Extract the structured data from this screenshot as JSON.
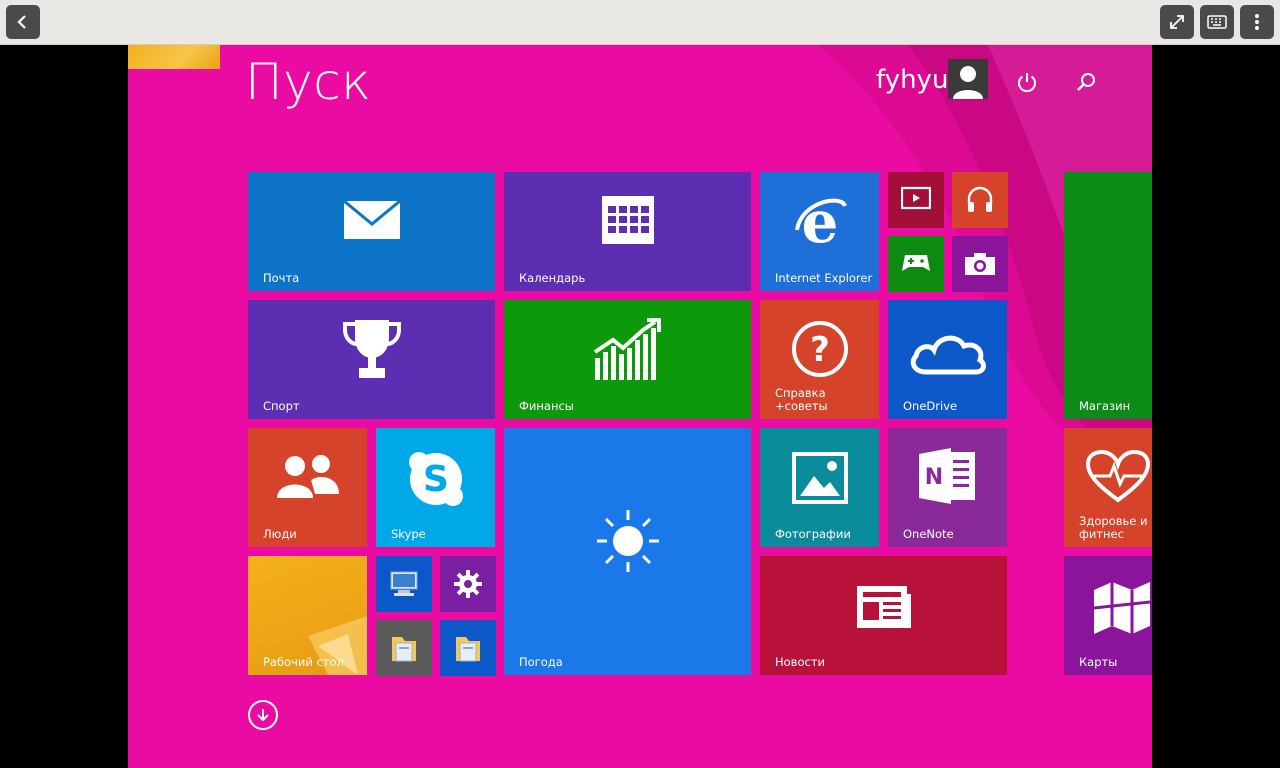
{
  "topbar": {
    "back_icon": "chevron-left-icon",
    "fullscreen_icon": "expand-icon",
    "keyboard_icon": "keyboard-icon",
    "menu_icon": "more-vertical-icon"
  },
  "start": {
    "title": "Пуск",
    "username": "fyhyu",
    "power_icon": "power-icon",
    "search_icon": "search-icon"
  },
  "tiles": {
    "mail": {
      "label": "Почта",
      "color": "#0d74c8",
      "icon": "mail-icon"
    },
    "calendar": {
      "label": "Календарь",
      "color": "#5b2eb2",
      "icon": "calendar-icon"
    },
    "ie": {
      "label": "Internet Explorer",
      "color": "#1f6fd8",
      "icon": "internet-explorer-icon"
    },
    "video": {
      "label": "",
      "color": "#a2103a",
      "icon": "video-icon"
    },
    "music": {
      "label": "",
      "color": "#d4432a",
      "icon": "headphones-icon"
    },
    "games": {
      "label": "",
      "color": "#0f8a10",
      "icon": "gamepad-icon"
    },
    "camera": {
      "label": "",
      "color": "#8b149a",
      "icon": "camera-icon"
    },
    "store": {
      "label": "Магазин",
      "color": "#0c8c17",
      "icon": "store-icon"
    },
    "sport": {
      "label": "Спорт",
      "color": "#5b2eb2",
      "icon": "trophy-icon"
    },
    "finance": {
      "label": "Финансы",
      "color": "#0c9a0a",
      "icon": "finance-chart-icon"
    },
    "help": {
      "label": "Справка\n+советы",
      "color": "#d4432a",
      "icon": "help-icon"
    },
    "onedrive": {
      "label": "OneDrive",
      "color": "#0d58c8",
      "icon": "cloud-icon"
    },
    "people": {
      "label": "Люди",
      "color": "#d4432a",
      "icon": "people-icon"
    },
    "skype": {
      "label": "Skype",
      "color": "#00a8e8",
      "icon": "skype-icon"
    },
    "weather": {
      "label": "Погода",
      "color": "#1b78e8",
      "icon": "sun-icon"
    },
    "photos": {
      "label": "Фотографии",
      "color": "#0a8c9a",
      "icon": "photos-icon"
    },
    "onenote": {
      "label": "OneNote",
      "color": "#8a2a9a",
      "icon": "onenote-icon"
    },
    "health": {
      "label": "Здоровье и\nфитнес",
      "color": "#d4432a",
      "icon": "heart-pulse-icon"
    },
    "desktop": {
      "label": "Рабочий стол",
      "color": "#e9a615",
      "icon": "desktop-wallpaper"
    },
    "computer": {
      "label": "",
      "color": "#0d58c8",
      "icon": "computer-icon"
    },
    "settings": {
      "label": "",
      "color": "#7a1fa2",
      "icon": "gear-icon"
    },
    "explorer1": {
      "label": "",
      "color": "#5a5a5a",
      "icon": "folder-icon"
    },
    "explorer2": {
      "label": "",
      "color": "#0d58c8",
      "icon": "folder-icon"
    },
    "news": {
      "label": "Новости",
      "color": "#b8123a",
      "icon": "news-icon"
    },
    "maps": {
      "label": "Карты",
      "color": "#8a149a",
      "icon": "map-icon"
    }
  },
  "all_apps_icon": "arrow-down-circle-icon"
}
